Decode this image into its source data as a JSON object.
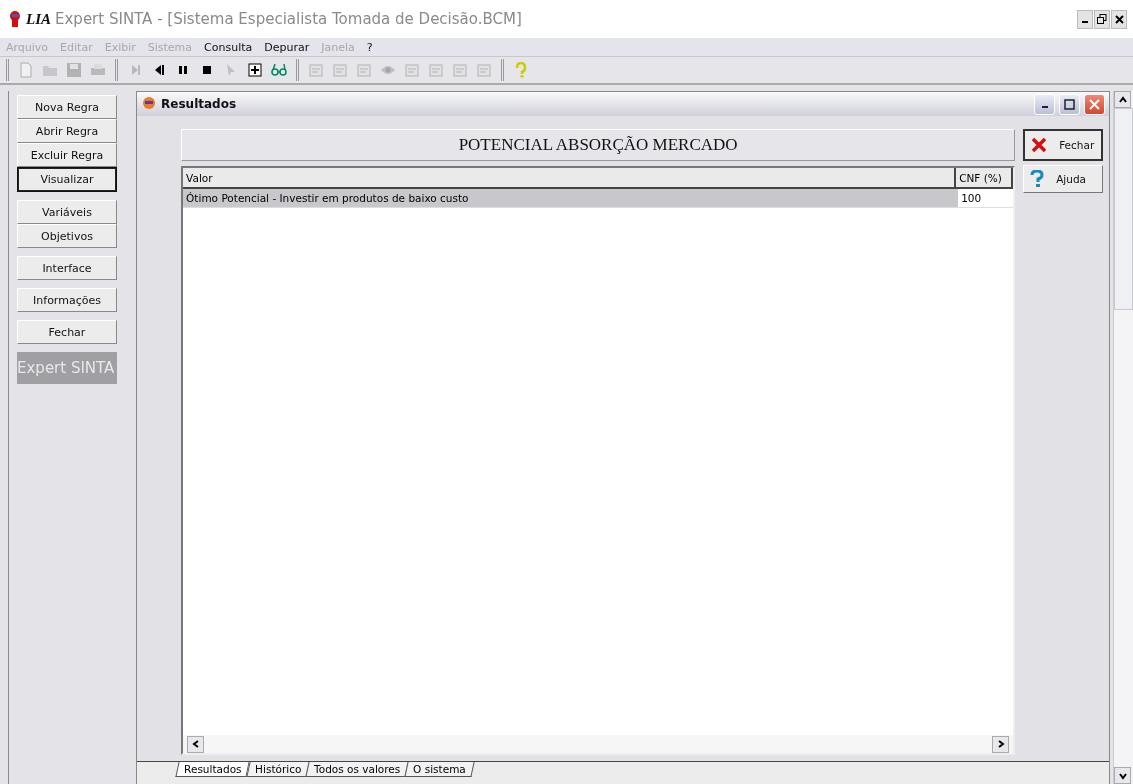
{
  "app": {
    "brand": "LIA",
    "title": "Expert SINTA - [Sistema Especialista Tomada de Decisão.BCM]"
  },
  "menu": [
    {
      "label": "Arquivo",
      "disabled": true
    },
    {
      "label": "Editar",
      "disabled": true
    },
    {
      "label": "Exibir",
      "disabled": true
    },
    {
      "label": "Sistema",
      "disabled": true
    },
    {
      "label": "Consulta",
      "disabled": false
    },
    {
      "label": "Depurar",
      "disabled": false
    },
    {
      "label": "Janela",
      "disabled": true
    },
    {
      "label": "?",
      "disabled": false
    }
  ],
  "toolbar": [
    [
      {
        "kind": "file",
        "disabled": true
      },
      {
        "kind": "folder",
        "disabled": true
      },
      {
        "kind": "disk",
        "disabled": true
      },
      {
        "kind": "printer",
        "disabled": true
      }
    ],
    [
      {
        "kind": "step",
        "disabled": true
      },
      {
        "kind": "back",
        "disabled": false
      },
      {
        "kind": "pause",
        "disabled": false
      },
      {
        "kind": "stop",
        "disabled": false
      },
      {
        "kind": "pointer",
        "disabled": true
      },
      {
        "kind": "plus",
        "disabled": false
      },
      {
        "kind": "glasses",
        "disabled": false
      }
    ],
    [
      {
        "kind": "form",
        "disabled": true
      },
      {
        "kind": "form",
        "disabled": true
      },
      {
        "kind": "form",
        "disabled": true
      },
      {
        "kind": "eye",
        "disabled": true
      },
      {
        "kind": "form",
        "disabled": true
      },
      {
        "kind": "form",
        "disabled": true
      },
      {
        "kind": "form",
        "disabled": true
      },
      {
        "kind": "form",
        "disabled": true
      }
    ],
    [
      {
        "kind": "help",
        "disabled": false
      }
    ]
  ],
  "sidebar": {
    "groups": [
      [
        {
          "label": "Nova Regra",
          "focused": false
        },
        {
          "label": "Abrir Regra",
          "focused": false
        },
        {
          "label": "Excluir Regra",
          "focused": false
        },
        {
          "label": "Visualizar",
          "focused": true
        }
      ],
      [
        {
          "label": "Variáveis",
          "focused": false
        },
        {
          "label": "Objetivos",
          "focused": false
        }
      ],
      [
        {
          "label": "Interface",
          "focused": false
        }
      ],
      [
        {
          "label": "Informações",
          "focused": false
        }
      ],
      [
        {
          "label": "Fechar",
          "focused": false
        }
      ]
    ],
    "logo": "Expert SINTA"
  },
  "results_window": {
    "title": "Resultados",
    "heading": "POTENCIAL ABSORÇÃO MERCADO",
    "table": {
      "columns": [
        "Valor",
        "CNF (%)"
      ],
      "rows": [
        {
          "cells": [
            "Ótimo Potencial - Investir em produtos de baixo custo",
            "100"
          ],
          "selected": true
        }
      ]
    },
    "buttons": [
      {
        "kind": "close",
        "label": "Fechar",
        "focused": true
      },
      {
        "kind": "help",
        "label": "Ajuda",
        "focused": false
      }
    ],
    "tabs": [
      {
        "label": "Resultados",
        "selected": true
      },
      {
        "label": "Histórico",
        "selected": false
      },
      {
        "label": "Todos os valores",
        "selected": false
      },
      {
        "label": "O sistema",
        "selected": false
      }
    ]
  }
}
